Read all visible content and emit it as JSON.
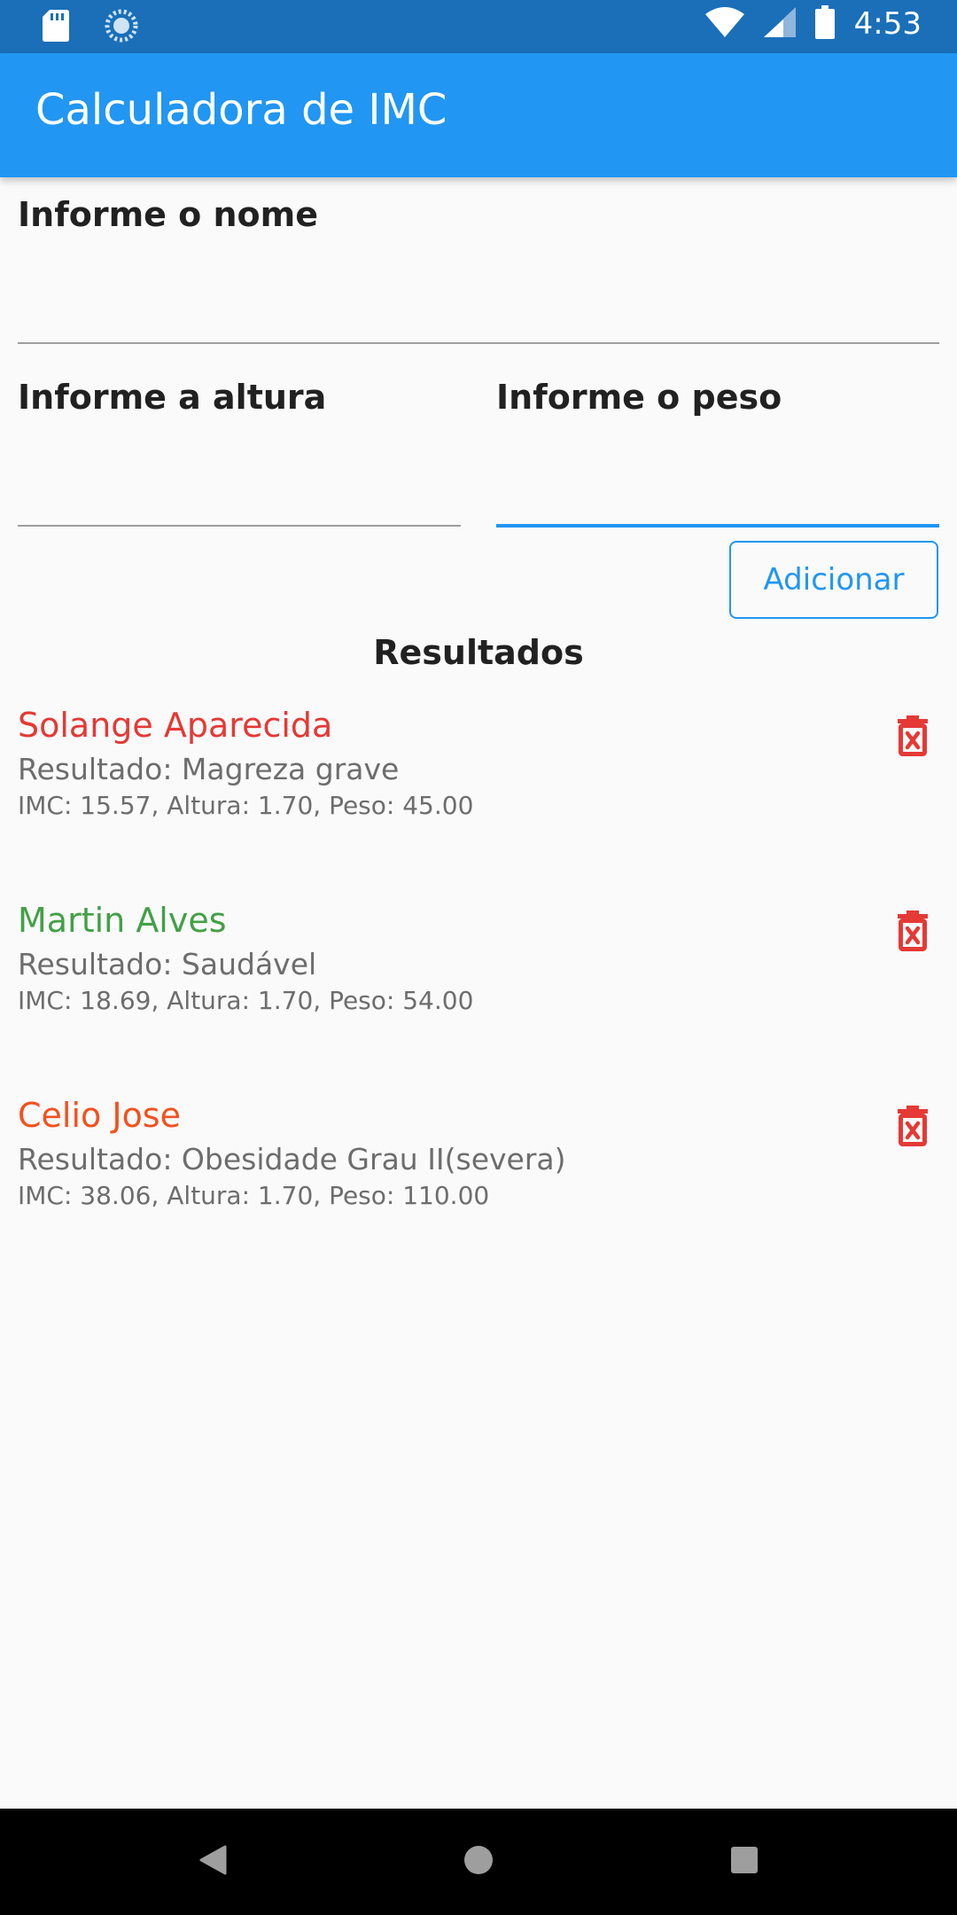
{
  "status_bar": {
    "time": "4:53",
    "icons": [
      "sd-card-icon",
      "loading-icon",
      "wifi-icon",
      "signal-icon",
      "battery-icon"
    ]
  },
  "app_bar": {
    "title": "Calculadora de IMC",
    "color": "#2196f3"
  },
  "form": {
    "name_label": "Informe o nome",
    "name_value": "",
    "height_label": "Informe a altura",
    "height_value": "",
    "weight_label": "Informe o peso",
    "weight_value": "",
    "add_button": "Adicionar"
  },
  "results": {
    "title": "Resultados",
    "items": [
      {
        "name": "Solange Aparecida",
        "status": "Resultado: Magreza grave",
        "details": "IMC: 15.57, Altura: 1.70, Peso: 45.00",
        "color": "#e53935",
        "delete_icon": "delete-forever-icon"
      },
      {
        "name": "Martin Alves",
        "status": "Resultado: Saudável",
        "details": "IMC: 18.69, Altura: 1.70, Peso: 54.00",
        "color": "#43a047",
        "delete_icon": "delete-forever-icon"
      },
      {
        "name": "Celio Jose",
        "status": "Resultado: Obesidade Grau II(severa)",
        "details": "IMC: 38.06, Altura: 1.70, Peso: 110.00",
        "color": "#f4511e",
        "delete_icon": "delete-forever-icon"
      }
    ]
  },
  "nav_bar": {
    "buttons": [
      "back-icon",
      "home-icon",
      "recents-icon"
    ]
  }
}
